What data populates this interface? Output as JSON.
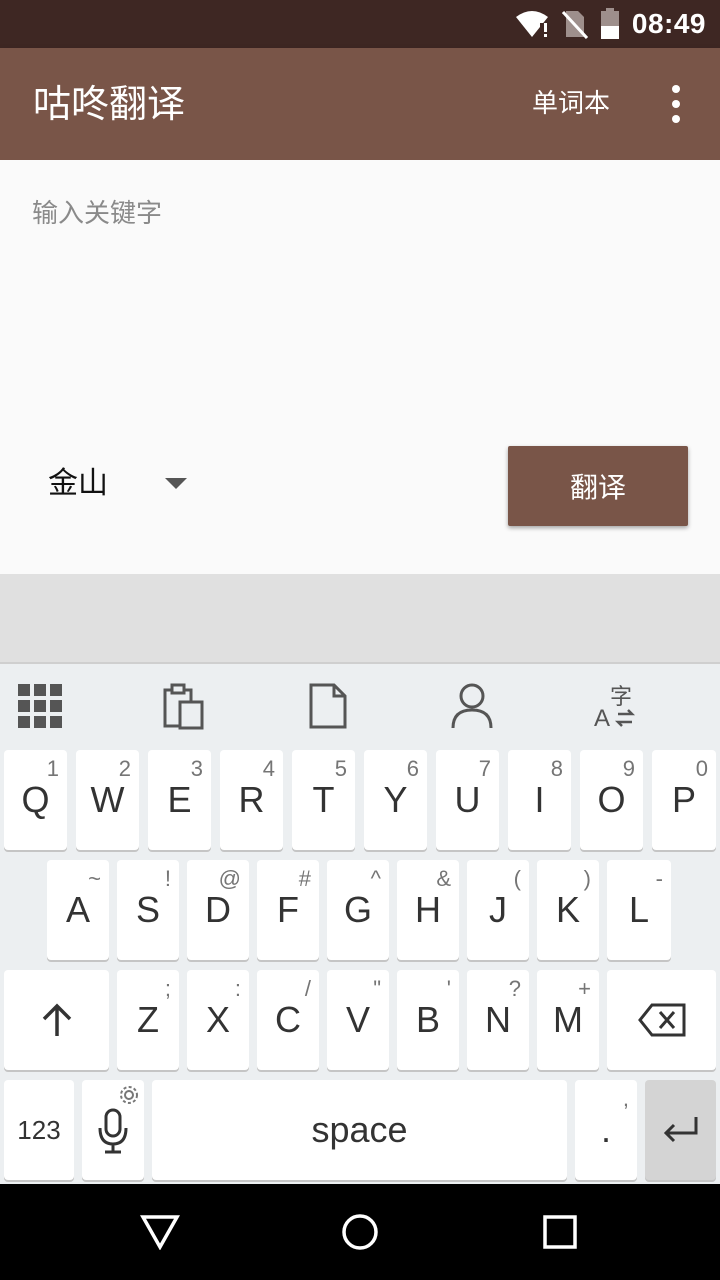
{
  "status_bar": {
    "time": "08:49",
    "icons": [
      "wifi-icon",
      "no-sim-icon",
      "battery-icon"
    ]
  },
  "app_bar": {
    "title": "咕咚翻译",
    "wordbook_label": "单词本",
    "overflow_icon": "more-vert-icon"
  },
  "input": {
    "placeholder": "输入关键字",
    "value": ""
  },
  "source_spinner": {
    "selected": "金山"
  },
  "translate_button": {
    "label": "翻译"
  },
  "keyboard": {
    "toolbar_icons": [
      "grid-icon",
      "clipboard-icon",
      "document-icon",
      "person-icon",
      "translate-icon"
    ],
    "row1": [
      {
        "main": "Q",
        "hint": "1"
      },
      {
        "main": "W",
        "hint": "2"
      },
      {
        "main": "E",
        "hint": "3"
      },
      {
        "main": "R",
        "hint": "4"
      },
      {
        "main": "T",
        "hint": "5"
      },
      {
        "main": "Y",
        "hint": "6"
      },
      {
        "main": "U",
        "hint": "7"
      },
      {
        "main": "I",
        "hint": "8"
      },
      {
        "main": "O",
        "hint": "9"
      },
      {
        "main": "P",
        "hint": "0"
      }
    ],
    "row2": [
      {
        "main": "A",
        "hint": "~"
      },
      {
        "main": "S",
        "hint": "!"
      },
      {
        "main": "D",
        "hint": "@"
      },
      {
        "main": "F",
        "hint": "#"
      },
      {
        "main": "G",
        "hint": "^"
      },
      {
        "main": "H",
        "hint": "&"
      },
      {
        "main": "J",
        "hint": "("
      },
      {
        "main": "K",
        "hint": ")"
      },
      {
        "main": "L",
        "hint": "-"
      }
    ],
    "row3": [
      {
        "main": "Z",
        "hint": ";"
      },
      {
        "main": "X",
        "hint": ":"
      },
      {
        "main": "C",
        "hint": "/"
      },
      {
        "main": "V",
        "hint": "\""
      },
      {
        "main": "B",
        "hint": "'"
      },
      {
        "main": "N",
        "hint": "?"
      },
      {
        "main": "M",
        "hint": "+"
      }
    ],
    "symbols_label": "123",
    "space_label": "space",
    "period_main": ".",
    "period_hint": ","
  },
  "nav_bar": {
    "icons": [
      "back-icon",
      "home-icon",
      "recents-icon"
    ]
  },
  "colors": {
    "primary": "#795548",
    "primary_dark": "#3e2723"
  }
}
